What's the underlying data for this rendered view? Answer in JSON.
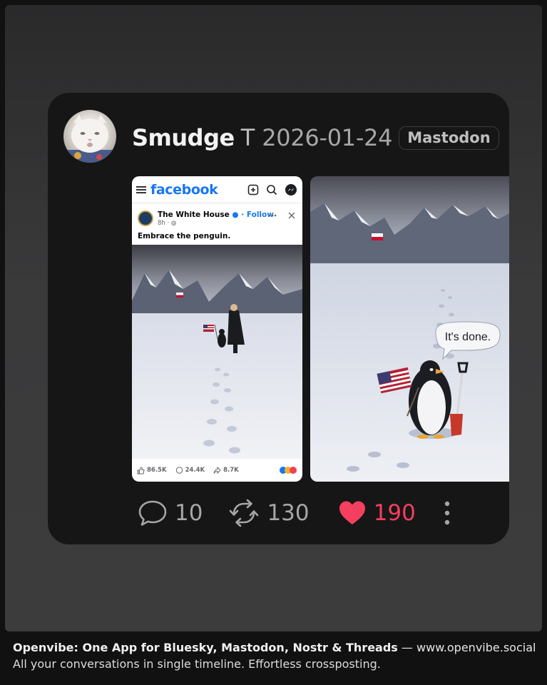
{
  "post": {
    "author": "Smudge",
    "author_initial": "T",
    "date": "2026-01-24",
    "platform": "Mastodon"
  },
  "embedded_facebook": {
    "logo": "facebook",
    "page_name": "The White House",
    "follow": "Follow",
    "time": "8h",
    "caption": "Embrace the penguin.",
    "likes": "86.5K",
    "comments": "24.4K",
    "shares": "8.7K"
  },
  "second_image": {
    "speech_bubble": "It's done."
  },
  "actions": {
    "replies": "10",
    "reposts": "130",
    "likes": "190"
  },
  "footer": {
    "app_name": "Openvibe: One App for Bluesky, Mastodon, Nostr & Threads",
    "separator": "—",
    "url": "www.openvibe.social",
    "tagline": "All your conversations in single timeline. Effortless crossposting."
  },
  "colors": {
    "like_accent": "#f43f5e",
    "facebook_blue": "#1877f2"
  }
}
